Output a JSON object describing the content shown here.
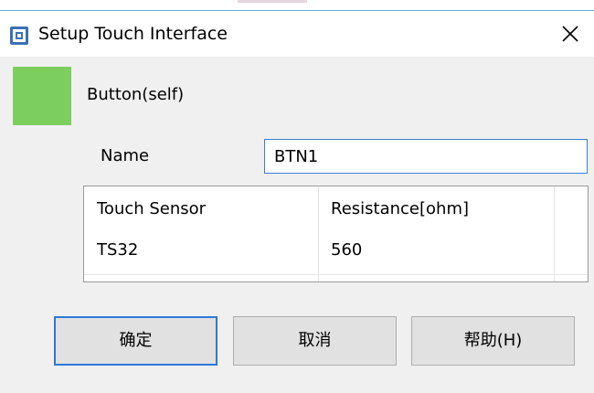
{
  "window": {
    "title": "Setup Touch Interface",
    "close_icon": "close-icon",
    "app_icon": "chip-icon"
  },
  "element": {
    "swatch_color": "#7ccf5f",
    "type_label": "Button(self)"
  },
  "name_field": {
    "label": "Name",
    "value": "BTN1"
  },
  "table": {
    "columns": [
      "Touch Sensor",
      "Resistance[ohm]"
    ],
    "rows": [
      [
        "TS32",
        "560"
      ]
    ]
  },
  "buttons": {
    "ok": "确定",
    "cancel": "取消",
    "help": "帮助(H)"
  },
  "colors": {
    "accent": "#2f78d6",
    "swatch": "#7ccf5f"
  }
}
